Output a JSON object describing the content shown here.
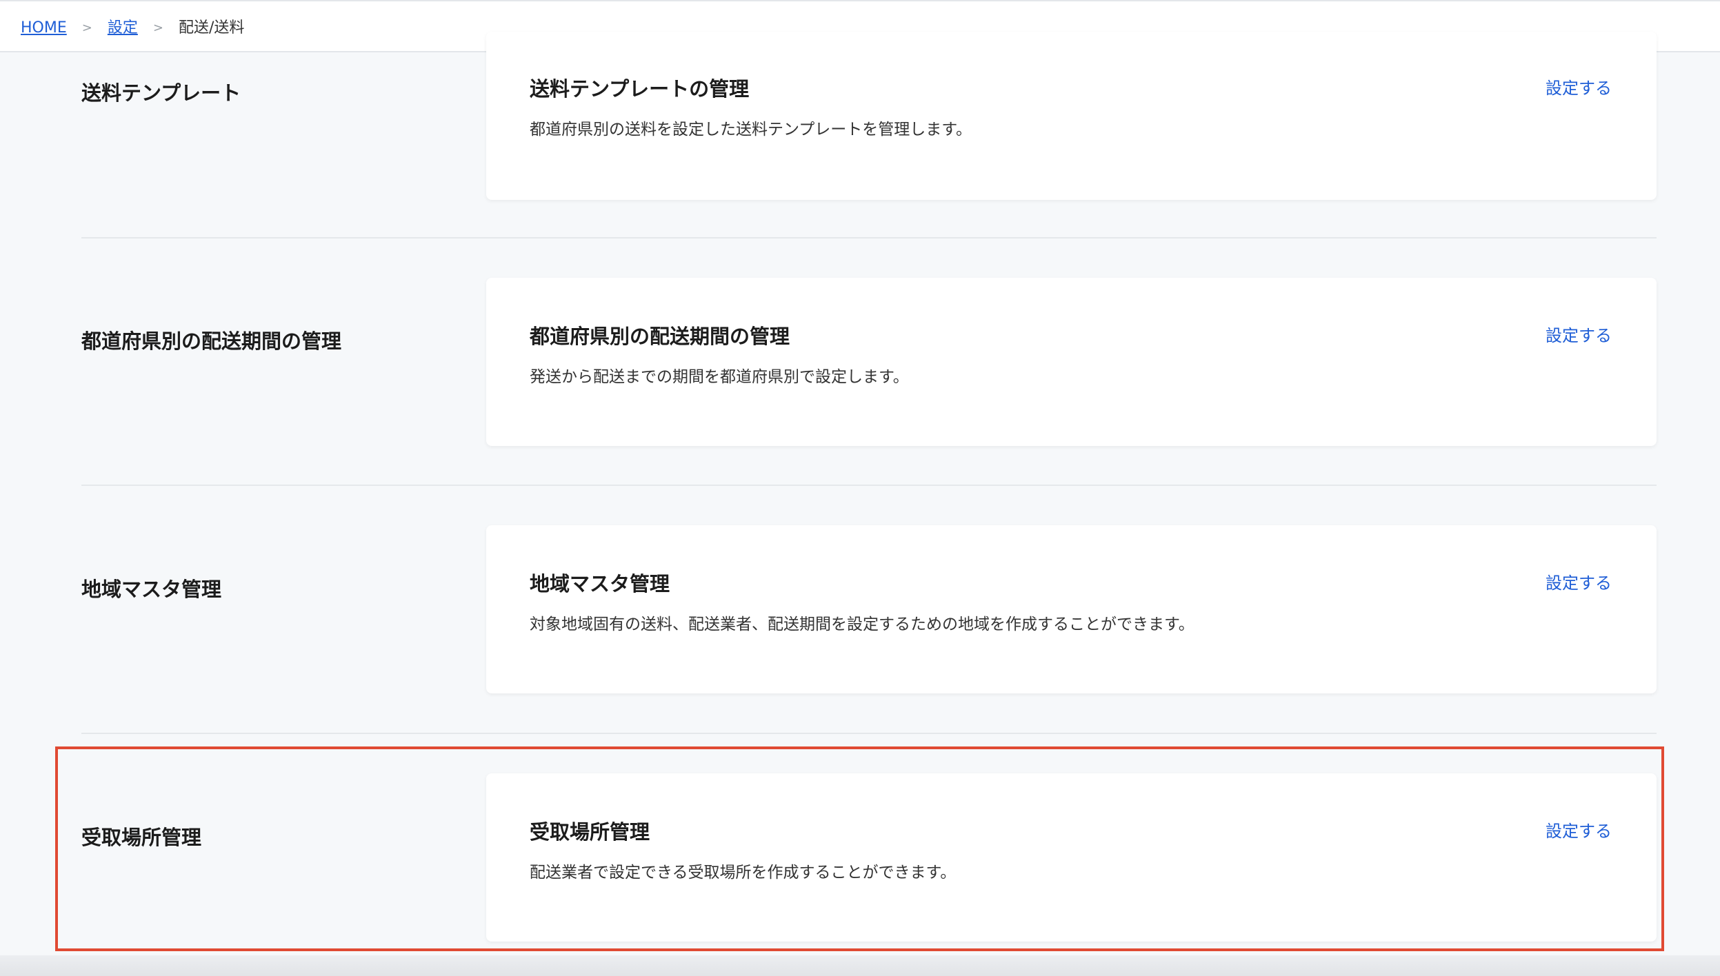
{
  "breadcrumb": {
    "home": "HOME",
    "separator": ">",
    "settings": "設定",
    "current": "配送/送料"
  },
  "sections": [
    {
      "label": "送料テンプレート",
      "title": "送料テンプレートの管理",
      "description": "都道府県別の送料を設定した送料テンプレートを管理します。",
      "action": "設定する"
    },
    {
      "label": "都道府県別の配送期間の管理",
      "title": "都道府県別の配送期間の管理",
      "description": "発送から配送までの期間を都道府県別で設定します。",
      "action": "設定する"
    },
    {
      "label": "地域マスタ管理",
      "title": "地域マスタ管理",
      "description": "対象地域固有の送料、配送業者、配送期間を設定するための地域を作成することができます。",
      "action": "設定する"
    },
    {
      "label": "受取場所管理",
      "title": "受取場所管理",
      "description": "配送業者で設定できる受取場所を作成することができます。",
      "action": "設定する"
    }
  ],
  "colors": {
    "accent_link": "#1f5ed6",
    "highlight_border": "#e04a33",
    "page_background": "#f6f8fa"
  }
}
